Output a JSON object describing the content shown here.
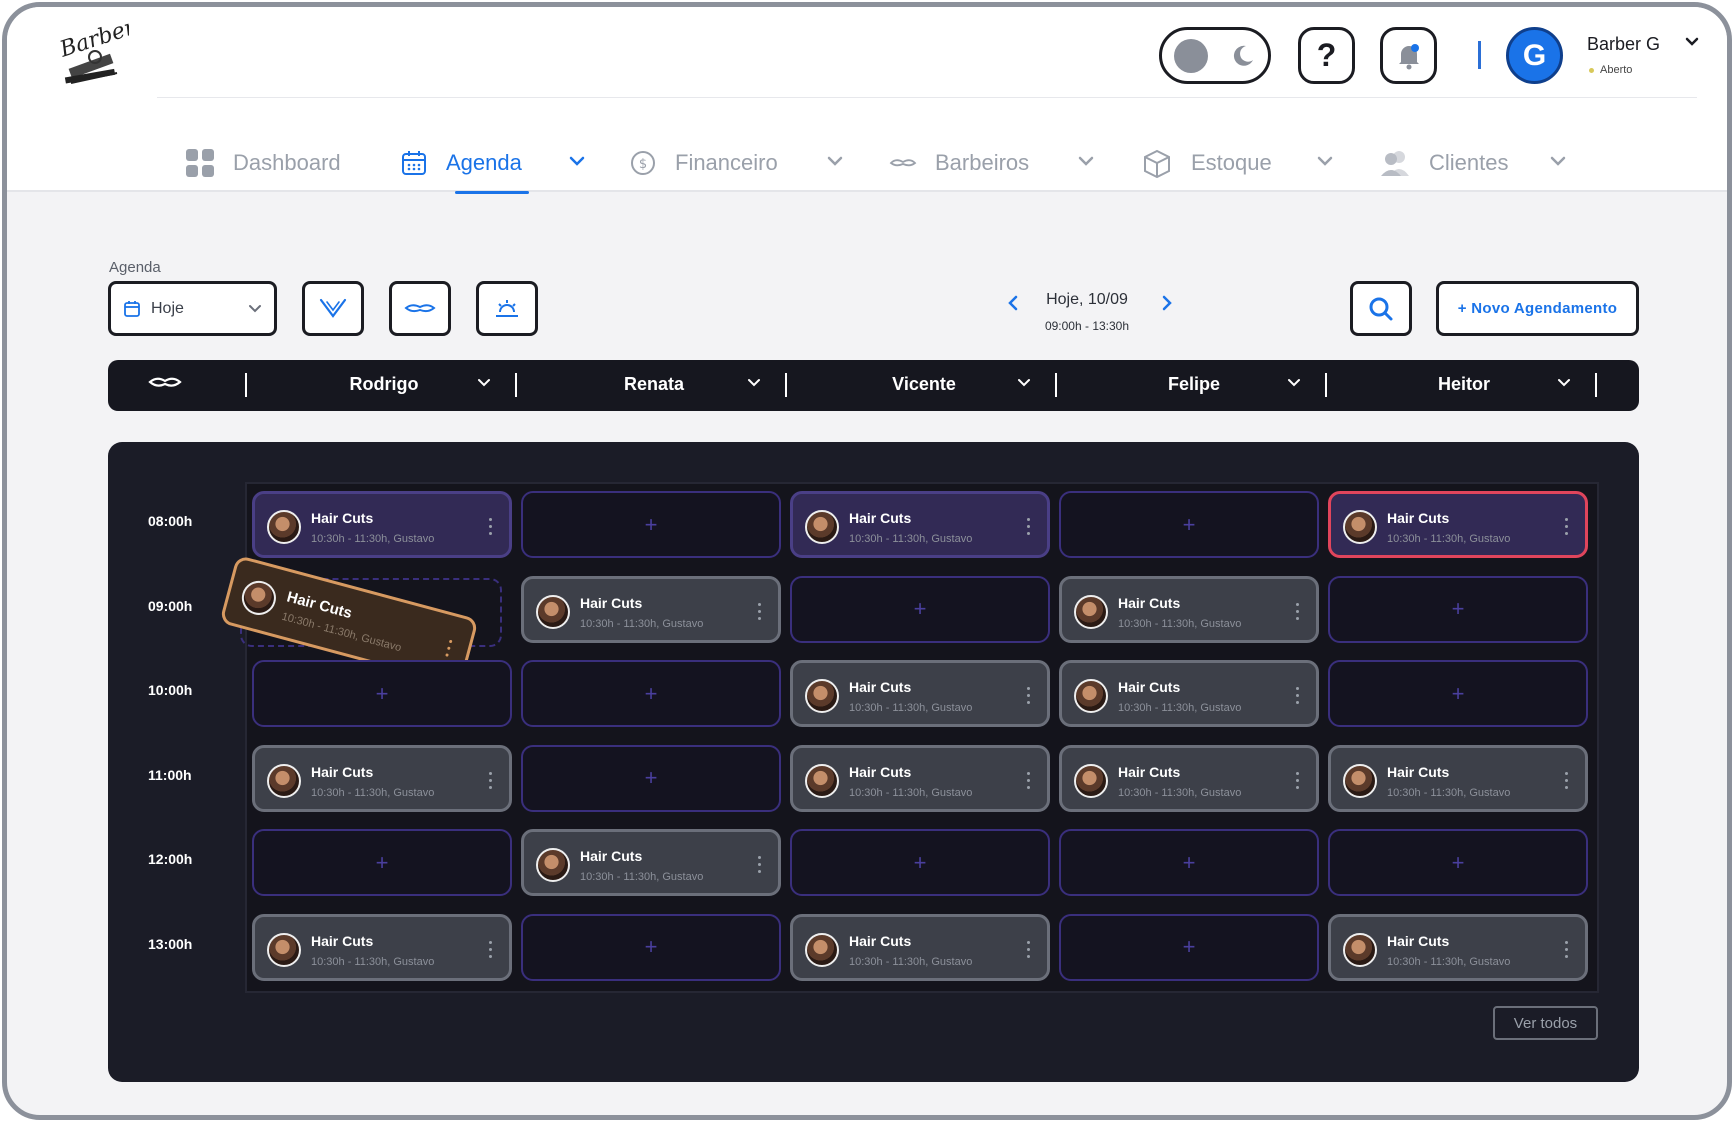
{
  "app": {
    "logo_text": "Barber"
  },
  "header": {
    "user_initial": "G",
    "user_name": "Barber G",
    "user_status": "Aberto",
    "help_label": "?"
  },
  "nav": {
    "items": [
      {
        "label": "Dashboard",
        "icon": "dashboard-grid-icon",
        "active": false
      },
      {
        "label": "Agenda",
        "icon": "calendar-icon",
        "active": true
      },
      {
        "label": "Financeiro",
        "icon": "dollar-icon",
        "active": false
      },
      {
        "label": "Barbeiros",
        "icon": "mustache-icon",
        "active": false
      },
      {
        "label": "Estoque",
        "icon": "box-icon",
        "active": false
      },
      {
        "label": "Clientes",
        "icon": "users-icon",
        "active": false
      }
    ]
  },
  "toolbar": {
    "agenda_label": "Agenda",
    "agenda_value": "Hoje",
    "date_main": "Hoje, 10/09",
    "date_sub": "09:00h - 13:30h",
    "new_button": "+ Novo Agendamento"
  },
  "barbers": [
    "Rodrigo",
    "Renata",
    "Vicente",
    "Felipe",
    "Heitor"
  ],
  "times": [
    "08:00h",
    "09:00h",
    "10:00h",
    "11:00h",
    "12:00h",
    "13:00h"
  ],
  "appointment": {
    "title": "Hair Cuts",
    "time": "10:30h - 11:30h, Gustavo"
  },
  "empty_label": "+",
  "footer": {
    "ver_todos": "Ver todos"
  },
  "colors": {
    "accent": "#1a73e8",
    "panel": "#1b1c27",
    "appt_gray": "#3d4049",
    "appt_purple": "#322a55",
    "highlight_red": "#e0455c",
    "drag_orange": "#d79a61"
  },
  "grid": [
    [
      "purple",
      "empty",
      "purple",
      "empty",
      "red"
    ],
    [
      "dragging",
      "gray",
      "empty",
      "gray",
      "empty"
    ],
    [
      "empty",
      "empty",
      "gray",
      "gray",
      "empty"
    ],
    [
      "gray",
      "empty",
      "gray",
      "gray",
      "gray"
    ],
    [
      "empty",
      "gray",
      "empty",
      "empty",
      "empty"
    ],
    [
      "gray",
      "empty",
      "gray",
      "empty",
      "gray"
    ]
  ]
}
